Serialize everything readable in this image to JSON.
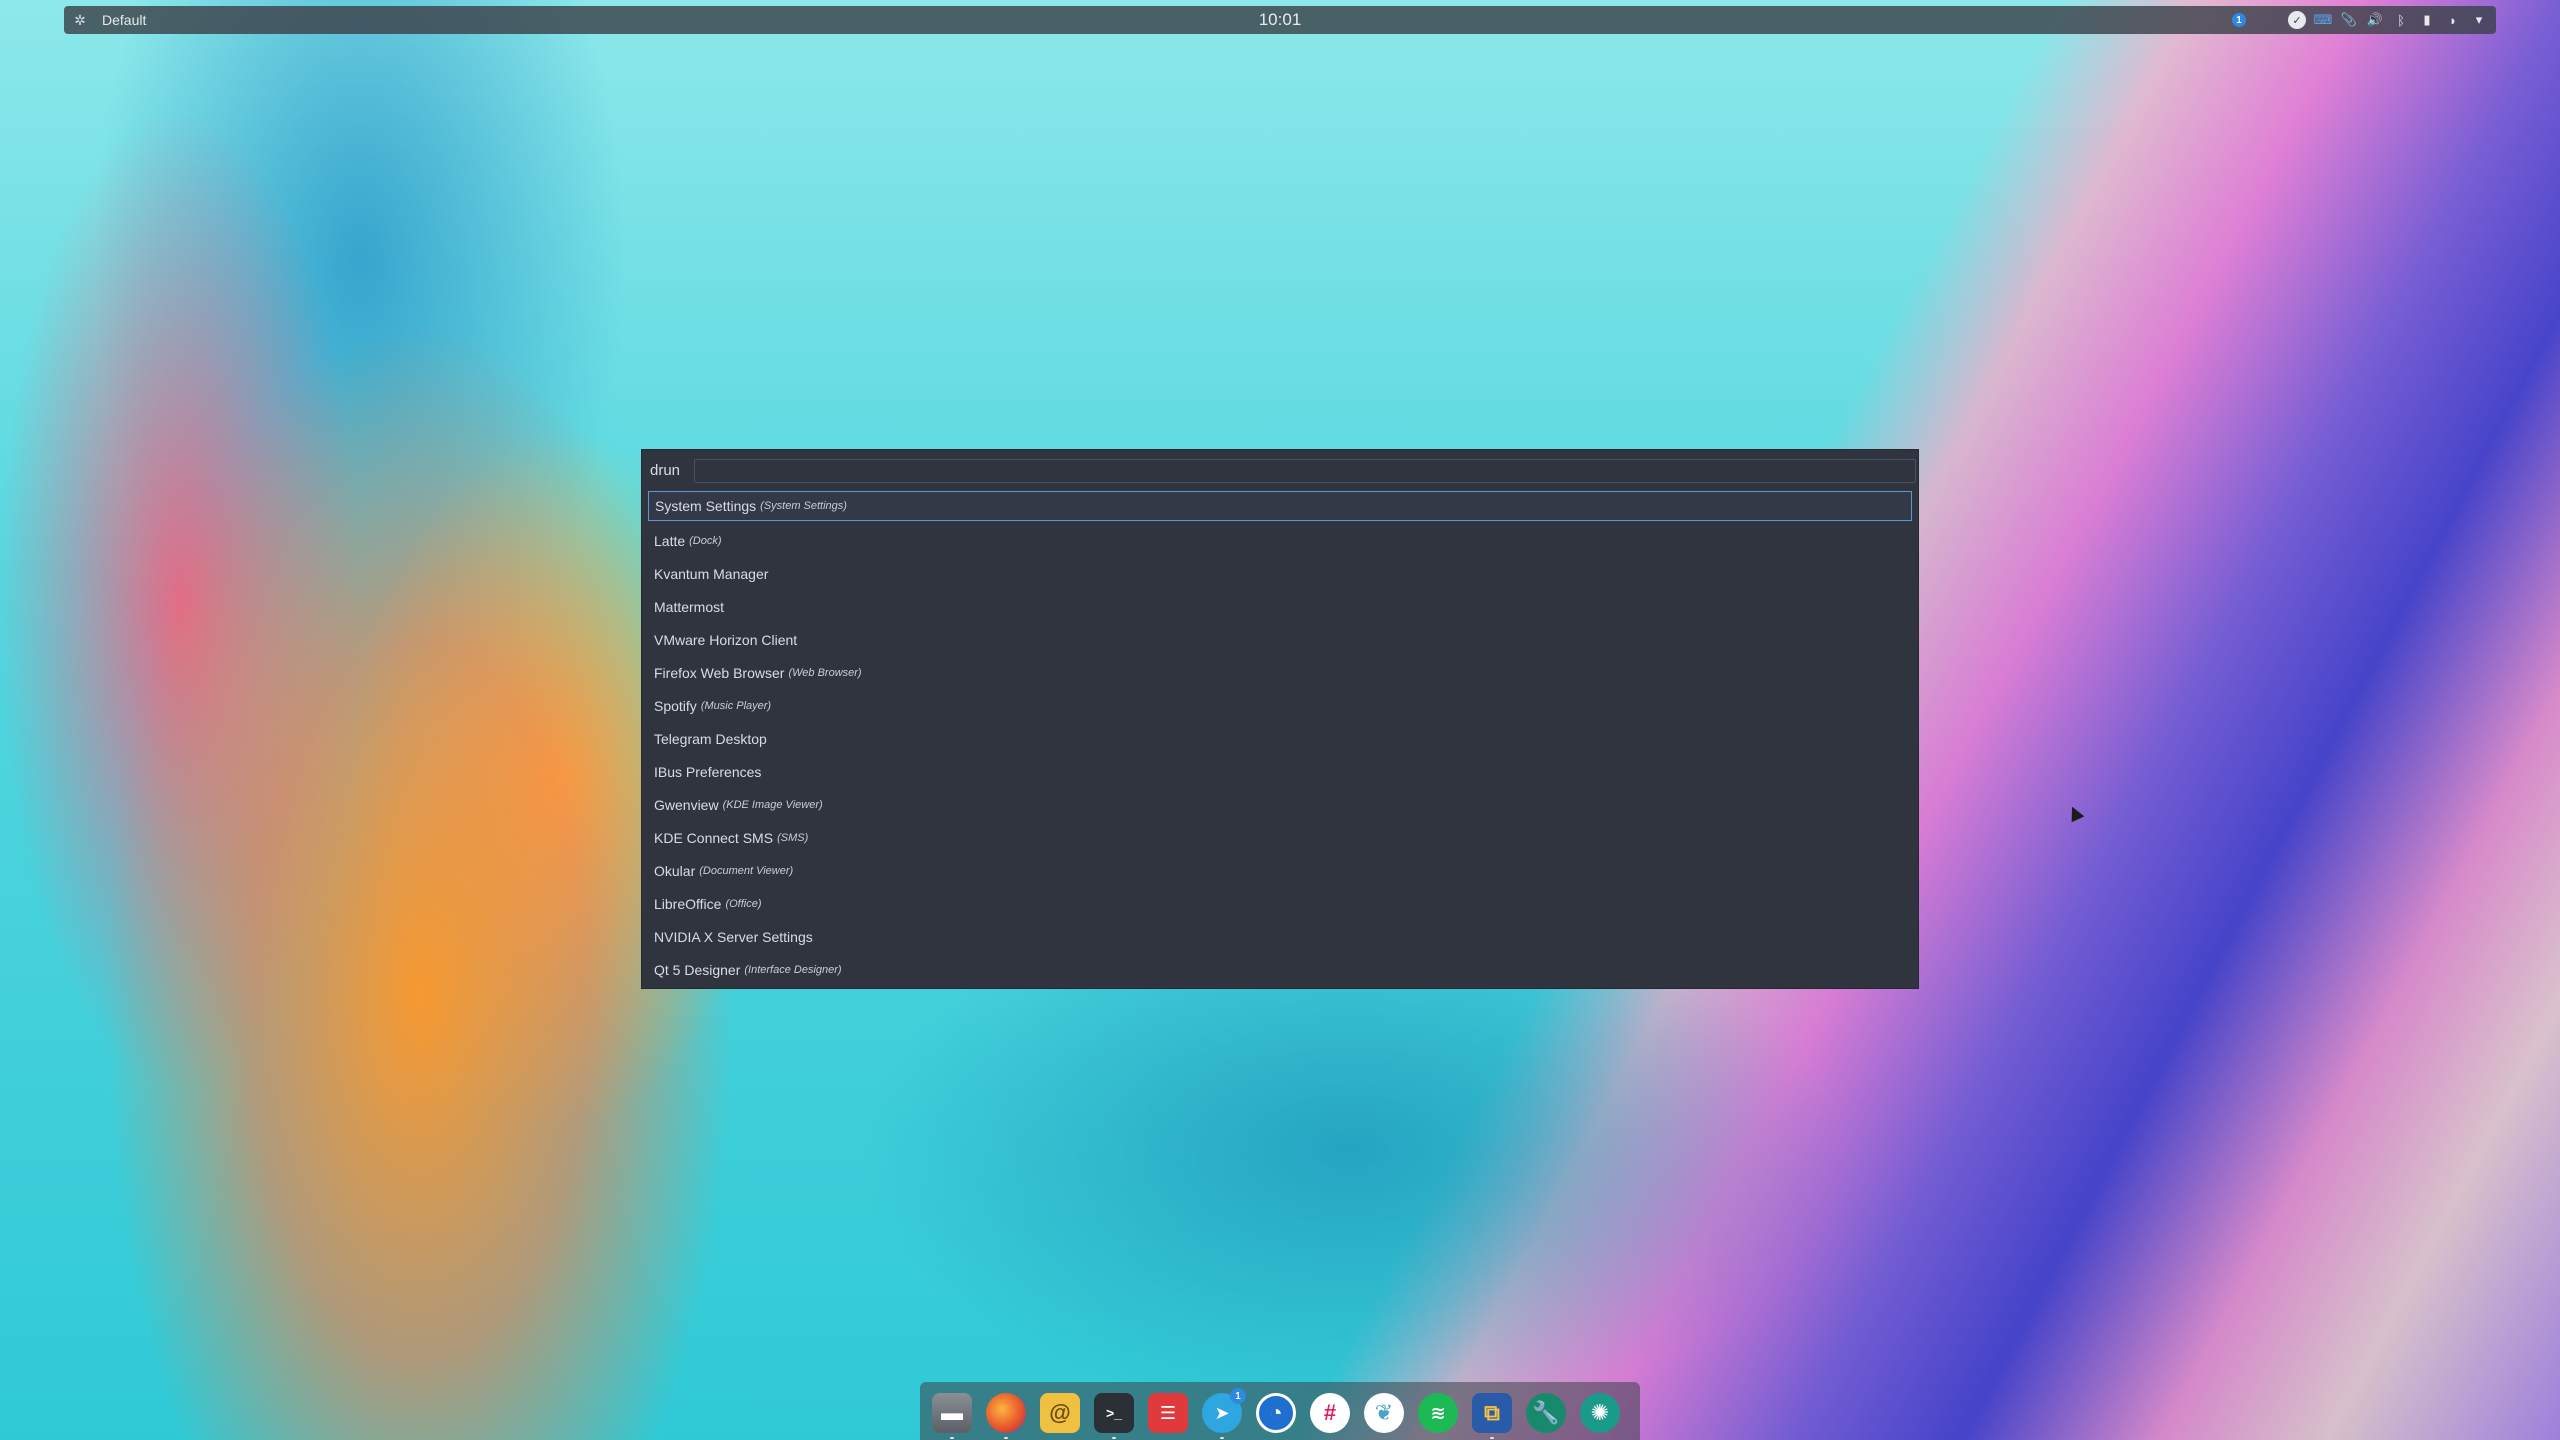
{
  "top_panel": {
    "activity": "Default",
    "clock": "10:01",
    "notification_count": "1"
  },
  "launcher": {
    "mode": "drun",
    "search_value": "",
    "items": [
      {
        "name": "System Settings",
        "generic": "(System Settings)",
        "selected": true
      },
      {
        "name": "Latte",
        "generic": "(Dock)"
      },
      {
        "name": "Kvantum Manager",
        "generic": ""
      },
      {
        "name": "Mattermost",
        "generic": ""
      },
      {
        "name": "VMware Horizon Client",
        "generic": ""
      },
      {
        "name": "Firefox Web Browser",
        "generic": "(Web Browser)"
      },
      {
        "name": "Spotify",
        "generic": "(Music Player)"
      },
      {
        "name": "Telegram Desktop",
        "generic": ""
      },
      {
        "name": "IBus Preferences",
        "generic": ""
      },
      {
        "name": "Gwenview",
        "generic": "(KDE Image Viewer)"
      },
      {
        "name": "KDE Connect SMS",
        "generic": "(SMS)"
      },
      {
        "name": "Okular",
        "generic": "(Document Viewer)"
      },
      {
        "name": "LibreOffice",
        "generic": "(Office)"
      },
      {
        "name": "NVIDIA X Server Settings",
        "generic": ""
      },
      {
        "name": "Qt 5 Designer",
        "generic": "(Interface Designer)"
      }
    ]
  },
  "dock": {
    "telegram_badge": "1"
  },
  "colors": {
    "launcher_bg": "#2f343f",
    "selection_border": "#5d96d0",
    "panel_bg": "#3c424a",
    "accent": "#2d8ae0"
  }
}
